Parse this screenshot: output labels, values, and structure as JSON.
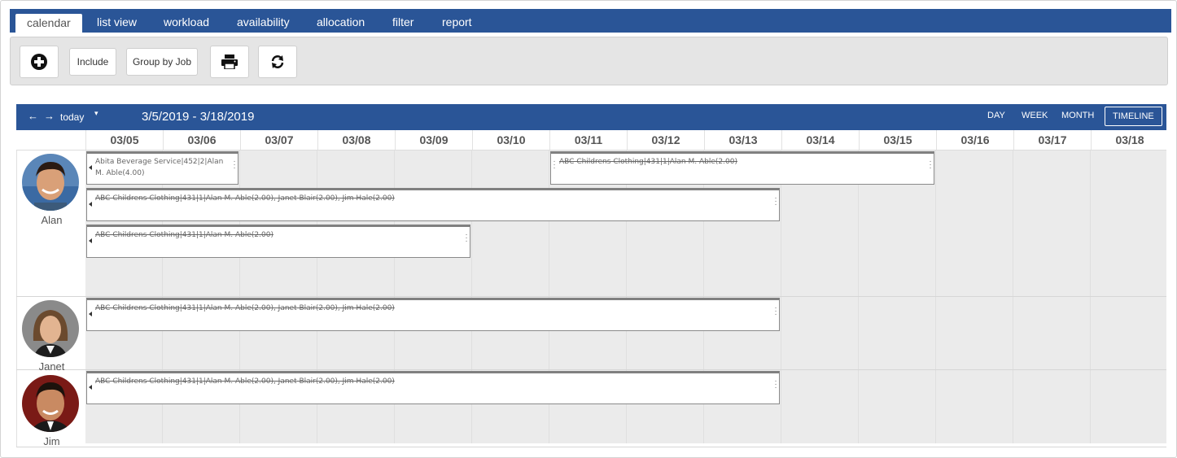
{
  "tabs": [
    {
      "label": "calendar",
      "active": true
    },
    {
      "label": "list view"
    },
    {
      "label": "workload"
    },
    {
      "label": "availability"
    },
    {
      "label": "allocation"
    },
    {
      "label": "filter"
    },
    {
      "label": "report"
    }
  ],
  "toolbar": {
    "add_icon": "plus-circle-icon",
    "include_label": "Include",
    "group_label": "Group by Job",
    "print_icon": "printer-icon",
    "refresh_icon": "refresh-icon"
  },
  "calendar": {
    "prev_icon": "←",
    "next_icon": "→",
    "today_label": "today",
    "today_caret": "▾",
    "range": "3/5/2019 - 3/18/2019",
    "views": [
      "DAY",
      "WEEK",
      "MONTH",
      "TIMELINE"
    ],
    "active_view": "TIMELINE",
    "dates": [
      "03/05",
      "03/06",
      "03/07",
      "03/08",
      "03/09",
      "03/10",
      "03/11",
      "03/12",
      "03/13",
      "03/14",
      "03/15",
      "03/16",
      "03/17",
      "03/18"
    ]
  },
  "resources": [
    {
      "name": "Alan"
    },
    {
      "name": "Janet"
    },
    {
      "name": "Jim"
    }
  ],
  "events": [
    {
      "text": "Abita Beverage Service|452|2|Alan M. Able(4.00)",
      "strike": false
    },
    {
      "text": "ABC Childrens Clothing|431|1|Alan M. Able(2.00)",
      "strike": true
    },
    {
      "text": "ABC Childrens Clothing|431|1|Alan M. Able(2.00), Janet Blair(2.00), Jim Hale(2.00)",
      "strike": true
    },
    {
      "text": "ABC Childrens Clothing|431|1|Alan M. Able(2.00)",
      "strike": true
    },
    {
      "text": "ABC Childrens Clothing|431|1|Alan M. Able(2.00), Janet Blair(2.00), Jim Hale(2.00)",
      "strike": true
    },
    {
      "text": "ABC Childrens Clothing|431|1|Alan M. Able(2.00), Janet Blair(2.00), Jim Hale(2.00)",
      "strike": true
    }
  ],
  "colors": {
    "header_blue": "#2a5597",
    "grid_bg": "#ebebeb",
    "event_border": "#808080"
  }
}
